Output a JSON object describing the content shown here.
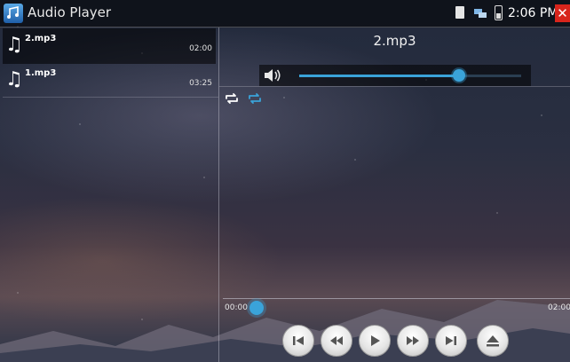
{
  "app": {
    "title": "Audio Player"
  },
  "status": {
    "time": "2:06 PM",
    "close_label": "✕"
  },
  "playlist": [
    {
      "name": "2.mp3",
      "duration": "02:00",
      "active": true
    },
    {
      "name": "1.mp3",
      "duration": "03:25",
      "active": false
    }
  ],
  "now_playing": {
    "title": "2.mp3",
    "volume_fraction": 0.72,
    "current_time": "00:00",
    "total_time": "02:00",
    "progress_fraction": 0.0
  },
  "controls": {
    "icons": [
      "previous-icon",
      "rewind-icon",
      "play-icon",
      "fast-forward-icon",
      "next-icon",
      "eject-icon"
    ]
  },
  "colors": {
    "accent": "#3aa3d9",
    "close": "#d8251c",
    "panel": "#000000"
  }
}
